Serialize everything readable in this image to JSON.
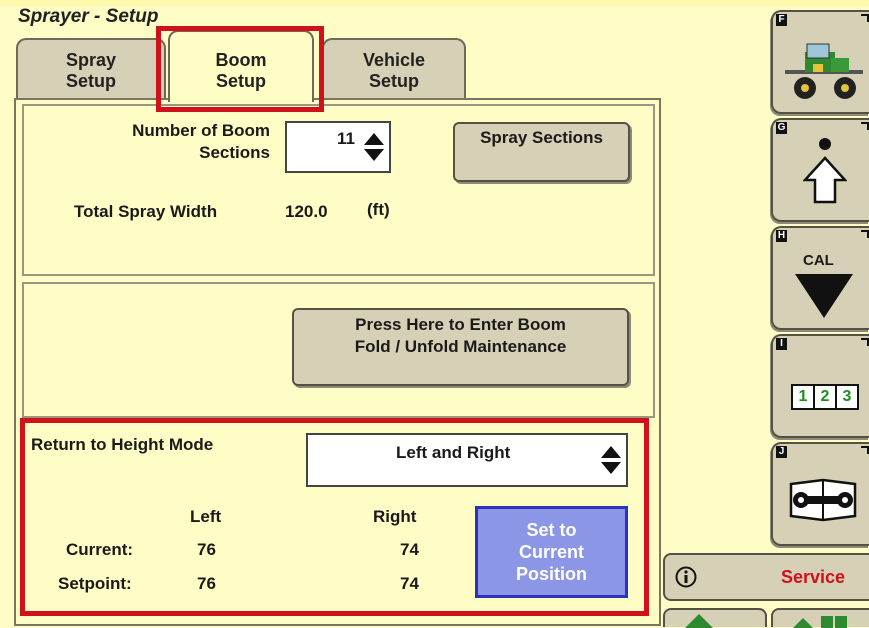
{
  "window": {
    "title": "Sprayer - Setup"
  },
  "tabs": [
    {
      "label_line1": "Spray",
      "label_line2": "Setup"
    },
    {
      "label_line1": "Boom",
      "label_line2": "Setup",
      "active": true
    },
    {
      "label_line1": "Vehicle",
      "label_line2": "Setup"
    }
  ],
  "boom_sections": {
    "label_line1": "Number of Boom",
    "label_line2": "Sections",
    "value": "11",
    "button_label": "Spray Sections"
  },
  "spray_width": {
    "label": "Total Spray Width",
    "value": "120.0",
    "unit": "(ft)"
  },
  "fold_button": {
    "line1": "Press Here to Enter Boom",
    "line2": "Fold / Unfold Maintenance"
  },
  "height_mode": {
    "label": "Return to Height Mode",
    "selected": "Left and Right",
    "col_left": "Left",
    "col_right": "Right",
    "row_current": "Current:",
    "row_setpoint": "Setpoint:",
    "current_left": "76",
    "current_right": "74",
    "setpoint_left": "76",
    "setpoint_right": "74",
    "set_button": {
      "line1": "Set to",
      "line2": "Current",
      "line3": "Position"
    }
  },
  "softkeys": [
    {
      "letter": "F",
      "icon": "sprayer-vehicle-icon"
    },
    {
      "letter": "G",
      "icon": "home-up-arrow-icon"
    },
    {
      "letter": "H",
      "icon": "cal-down-triangle-icon",
      "text": "CAL"
    },
    {
      "letter": "I",
      "icon": "number-123-icon",
      "digits": [
        "1",
        "2",
        "3"
      ]
    },
    {
      "letter": "J",
      "icon": "wrench-manual-icon"
    }
  ],
  "service": {
    "label": "Service",
    "icon": "info-icon",
    "color": "#D0101A"
  },
  "colors": {
    "background": "#FFFDC6",
    "tab": "#D6D1B6",
    "highlight": "#D0101A",
    "set_button": "#8C96E6"
  }
}
